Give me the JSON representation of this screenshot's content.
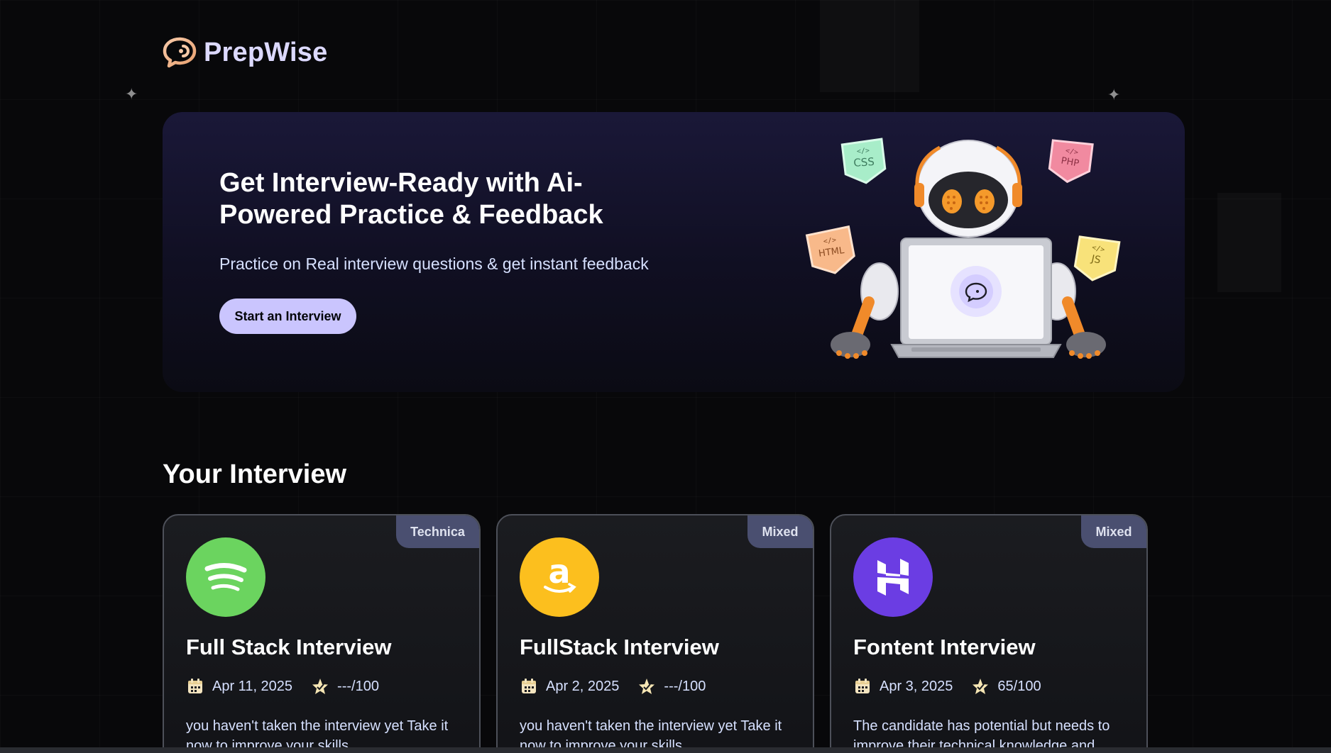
{
  "brand": {
    "name": "PrepWise"
  },
  "hero": {
    "title": "Get Interview-Ready with Ai-Powered Practice & Feedback",
    "subtitle": "Practice on Real interview questions & get instant feedback",
    "cta_label": "Start an Interview",
    "tech_badges": [
      "CSS",
      "PHP",
      "HTML",
      "JS"
    ]
  },
  "section": {
    "title": "Your Interview"
  },
  "interviews": [
    {
      "company": "spotify",
      "type": "Technica",
      "title": "Full Stack Interview",
      "date": "Apr 11, 2025",
      "score": "---/100",
      "description": "you haven't taken the interview yet Take it now to improve your skills"
    },
    {
      "company": "amazon",
      "type": "Mixed",
      "title": "FullStack Interview",
      "date": "Apr 2, 2025",
      "score": "---/100",
      "description": "you haven't taken the interview yet Take it now to improve your skills"
    },
    {
      "company": "hostinger",
      "type": "Mixed",
      "title": "Fontent Interview",
      "date": "Apr 3, 2025",
      "score": "65/100",
      "description": "The candidate has potential but needs to improve their technical knowledge and"
    }
  ],
  "colors": {
    "background": "#08080a",
    "accent": "#cac5fe",
    "badge": "#4a4f70",
    "spotify": "#6bd45f",
    "amazon": "#fcbf1e",
    "hostinger": "#6b3de3"
  }
}
